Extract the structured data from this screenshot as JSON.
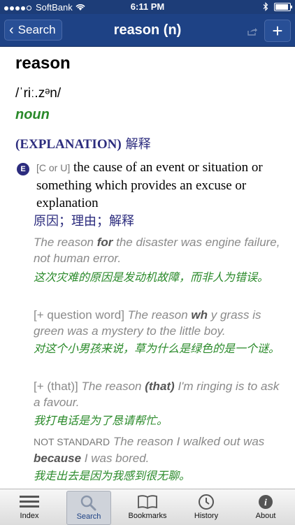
{
  "status_bar": {
    "carrier": "SoftBank",
    "time": "6:11 PM"
  },
  "nav": {
    "back_label": "Search",
    "title": "reason (n)",
    "add_label": "+"
  },
  "entry": {
    "headword": "reason",
    "pronunciation": "/ˈriː.zᵊn/",
    "part_of_speech": "noun",
    "sense_label": "(EXPLANATION)",
    "sense_zh": "解释",
    "badge": "E",
    "grammar": "[C or U]",
    "definition": "the cause of an event or situation or something which provides an excuse or explanation",
    "definition_zh": "原因；理由；解释",
    "examples": [
      {
        "before": "The reason ",
        "bold": "for",
        "after": " the disaster was engine failure, not human error.",
        "zh": "这次灾难的原因是发动机故障，而非人为错误。"
      },
      {
        "grammar": "[+ question word]",
        "before": " The reason ",
        "bold": "wh",
        "after": " y grass is green was a mystery to the little boy.",
        "zh": "对这个小男孩来说，草为什么是绿色的是一个谜。"
      },
      {
        "grammar": "[+ (that)]",
        "before": " The reason ",
        "bold": "(that)",
        "after": " I'm ringing is to ask a favour.",
        "zh": "我打电话是为了恳请帮忙。"
      },
      {
        "label": "NOT STANDARD",
        "before": " The reason I walked out was ",
        "bold": "because",
        "after": " I was bored.",
        "zh": "我走出去是因为我感到很无聊。"
      }
    ]
  },
  "tabs": [
    {
      "label": "Index"
    },
    {
      "label": "Search"
    },
    {
      "label": "Bookmarks"
    },
    {
      "label": "History"
    },
    {
      "label": "About"
    }
  ],
  "colors": {
    "nav": "#1e4285",
    "accent_green": "#2a8a2a",
    "sense_blue": "#2c2c7e"
  }
}
